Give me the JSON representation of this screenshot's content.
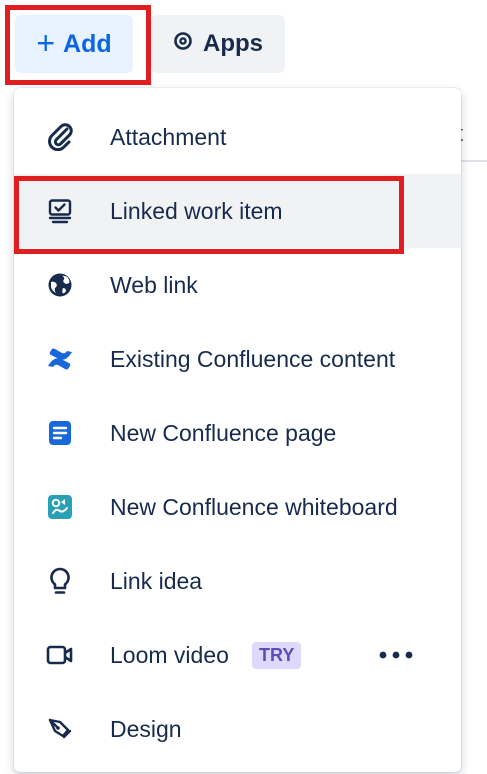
{
  "toolbar": {
    "add_label": "Add",
    "add_plus": "+",
    "apps_label": "Apps"
  },
  "background": {
    "tab_fragment": "st"
  },
  "menu": {
    "items": [
      {
        "label": "Attachment",
        "icon": "paperclip-icon"
      },
      {
        "label": "Linked work item",
        "icon": "linked-work-item-icon"
      },
      {
        "label": "Web link",
        "icon": "globe-icon"
      },
      {
        "label": "Existing Confluence content",
        "icon": "confluence-logo-icon"
      },
      {
        "label": "New Confluence page",
        "icon": "confluence-page-icon"
      },
      {
        "label": "New Confluence whiteboard",
        "icon": "confluence-whiteboard-icon"
      },
      {
        "label": "Link idea",
        "icon": "lightbulb-icon"
      },
      {
        "label": "Loom video",
        "icon": "video-camera-icon",
        "badge": "TRY"
      },
      {
        "label": "Design",
        "icon": "pen-tool-icon"
      }
    ]
  },
  "colors": {
    "accent": "#0c66e4",
    "highlight_frame": "#e01e22",
    "badge_bg": "#dfd8fd",
    "badge_text": "#5e4db2"
  }
}
